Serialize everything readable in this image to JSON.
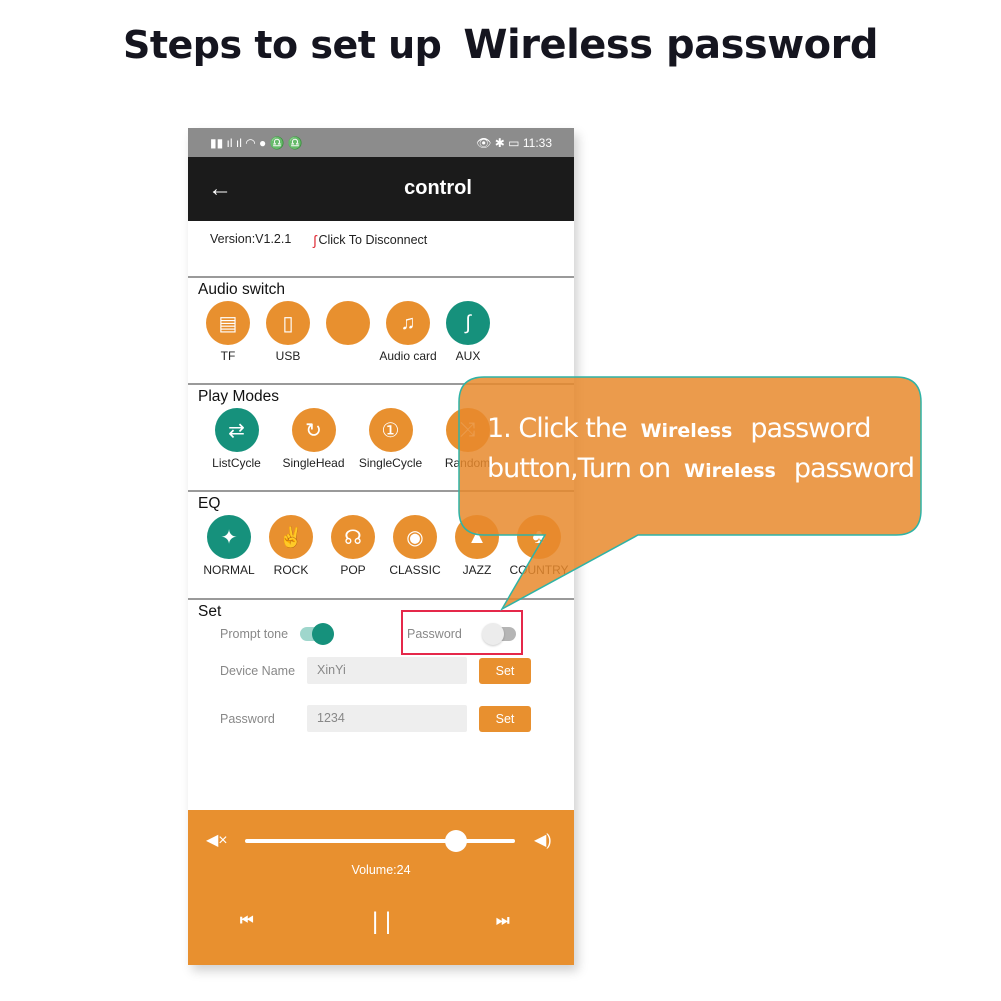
{
  "page_title_prefix": "Steps to set up",
  "page_title_main": "Wireless password",
  "status_bar": {
    "left_icons": "sim-signal-wifi-wechat",
    "time": "11:33"
  },
  "header": {
    "title": "control",
    "back_icon": "arrow-left-icon"
  },
  "version": "Version:V1.2.1",
  "disconnect_label": "Click To Disconnect",
  "audio_switch": {
    "title": "Audio switch",
    "items": [
      {
        "label": "TF",
        "icon": "sd-card-icon",
        "active": false
      },
      {
        "label": "USB",
        "icon": "usb-icon",
        "active": false
      },
      {
        "label": "",
        "icon": "blank-icon",
        "active": false
      },
      {
        "label": "Audio card",
        "icon": "music-note-icon",
        "active": false
      },
      {
        "label": "AUX",
        "icon": "aux-cable-icon",
        "active": true
      }
    ]
  },
  "play_modes": {
    "title": "Play Modes",
    "items": [
      {
        "label": "ListCycle",
        "icon": "list-cycle-icon",
        "active": true
      },
      {
        "label": "SingleHead",
        "icon": "single-head-icon",
        "active": false
      },
      {
        "label": "SingleCycle",
        "icon": "single-cycle-icon",
        "active": false
      },
      {
        "label": "Random",
        "icon": "shuffle-icon",
        "active": false
      }
    ]
  },
  "eq": {
    "title": "EQ",
    "items": [
      {
        "label": "NORMAL",
        "icon": "normal-icon",
        "active": true
      },
      {
        "label": "ROCK",
        "icon": "rock-hand-icon",
        "active": false
      },
      {
        "label": "POP",
        "icon": "headphones-icon",
        "active": false
      },
      {
        "label": "CLASSIC",
        "icon": "disc-icon",
        "active": false
      },
      {
        "label": "JAZZ",
        "icon": "hat-icon",
        "active": false
      },
      {
        "label": "COUNTRY",
        "icon": "country-icon",
        "active": false
      }
    ]
  },
  "set": {
    "title": "Set",
    "prompt_tone_label": "Prompt tone",
    "prompt_tone_on": true,
    "password_toggle_label": "Password",
    "password_toggle_on": false,
    "device_name_label": "Device Name",
    "device_name_value": "XinYi",
    "password_label": "Password",
    "password_value": "1234",
    "set_button": "Set"
  },
  "player": {
    "volume_label": "Volume:24",
    "volume_fraction": 0.78
  },
  "callout": {
    "l1a": "1. Click the",
    "w": "Wireless",
    "pw": "password",
    "l2a": "button,Turn on"
  },
  "colors": {
    "orange": "#e8902f",
    "teal": "#16917c",
    "highlight": "#e5284a"
  }
}
